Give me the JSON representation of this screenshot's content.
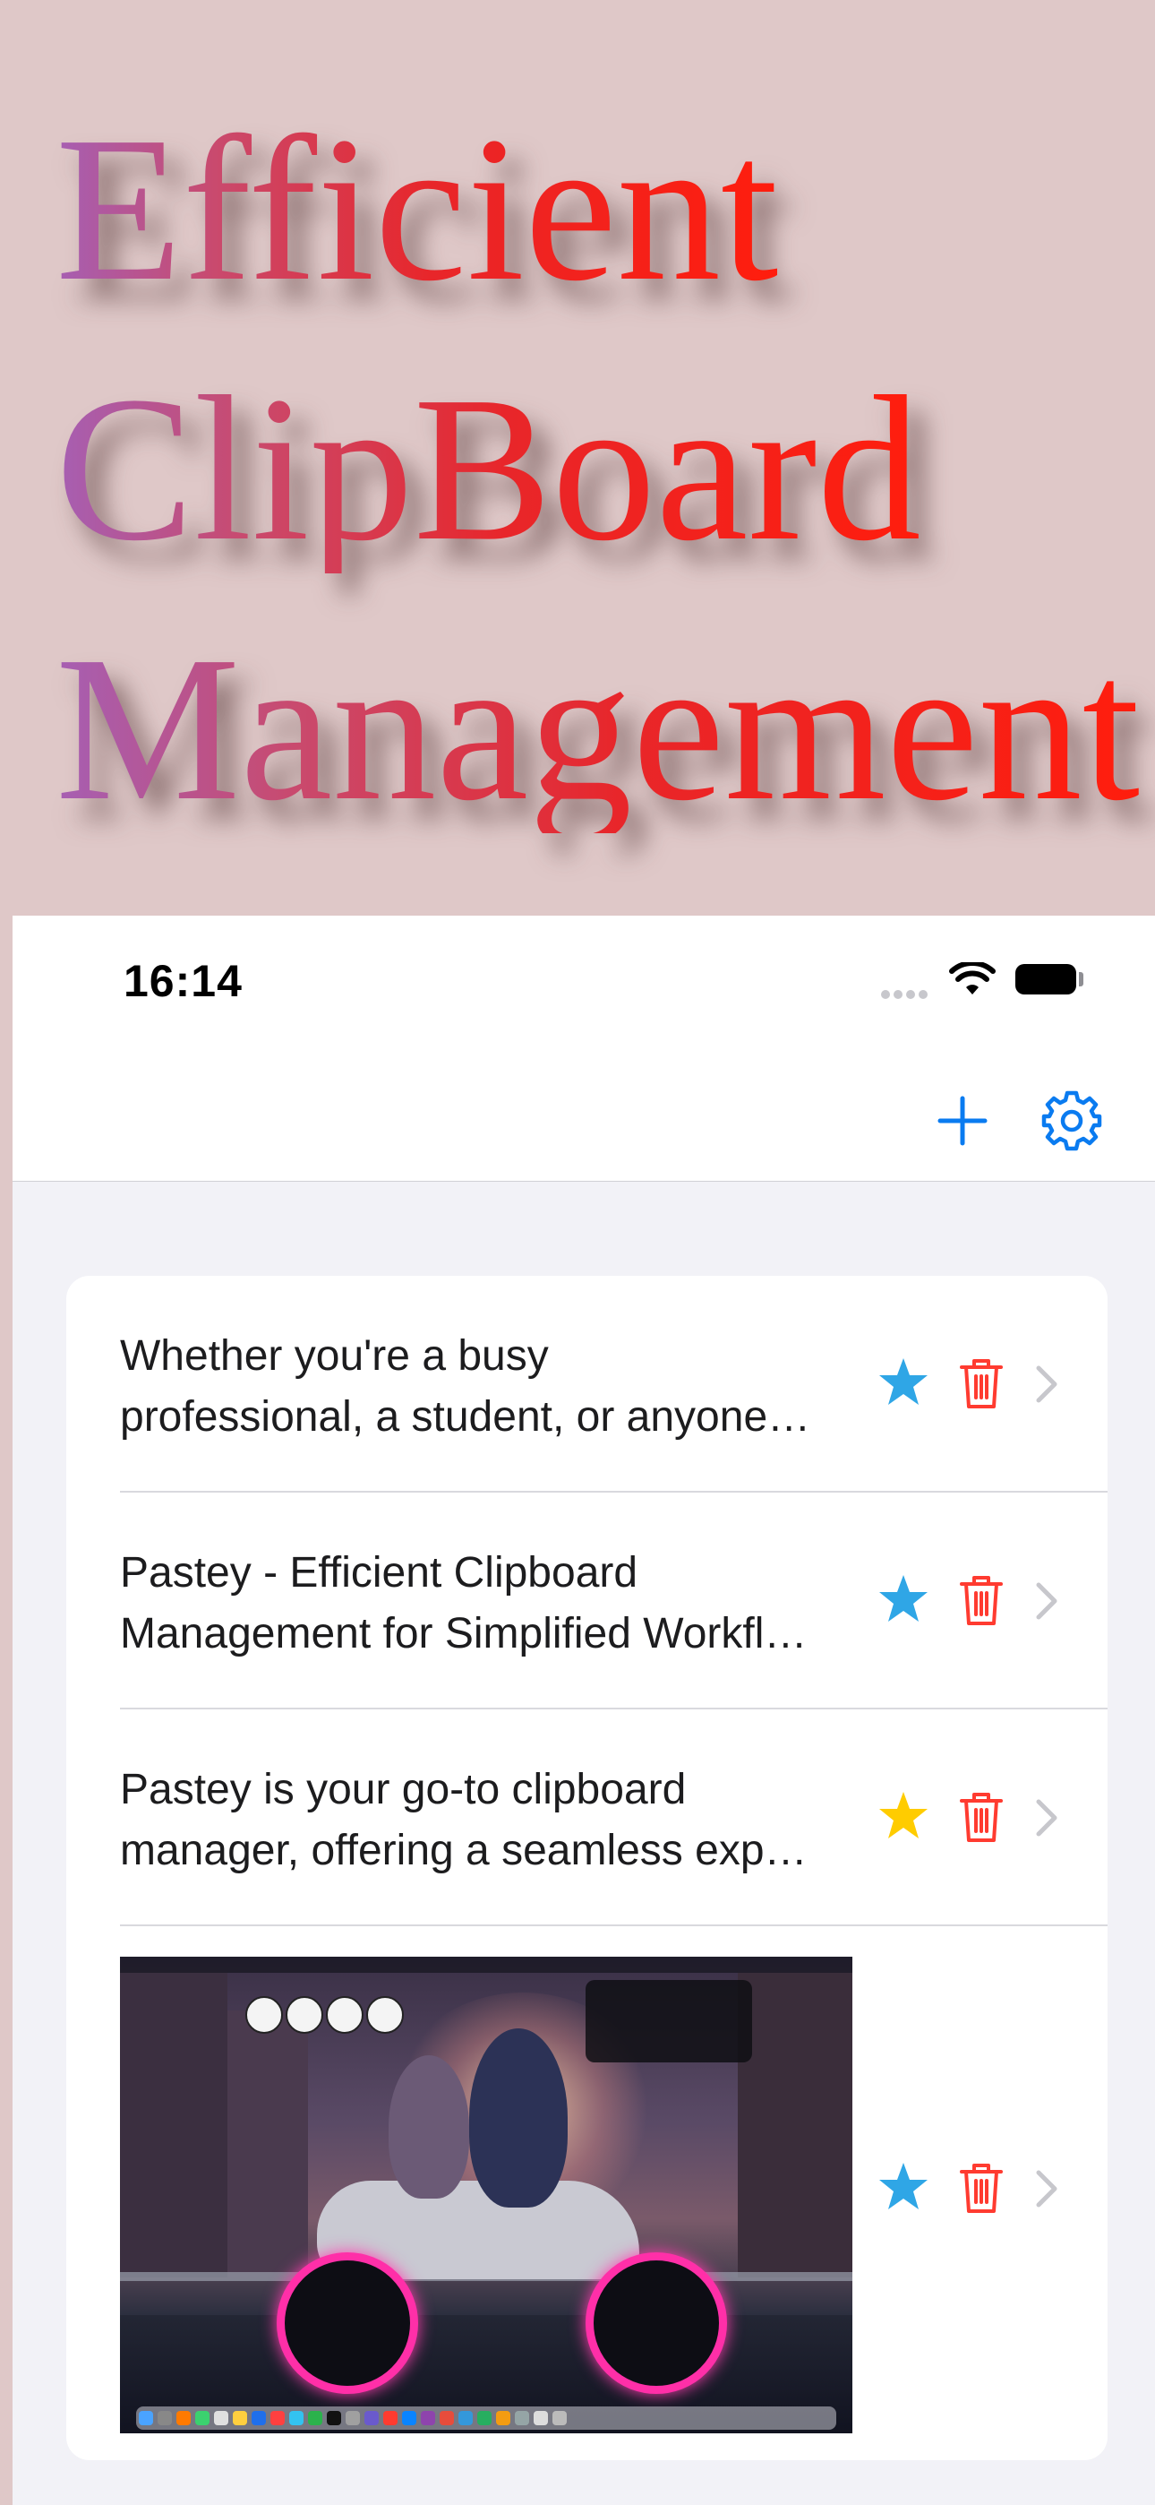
{
  "promo": {
    "line1": "Efficient",
    "line2": "ClipBoard",
    "line3": "Management"
  },
  "status_bar": {
    "time": "16:14"
  },
  "toolbar": {
    "add_icon": "plus-icon",
    "settings_icon": "gear-icon"
  },
  "colors": {
    "accent": "#0a7bf0",
    "star_blue": "#2fa6e6",
    "star_gold": "#ffcc00",
    "trash_red": "#ff3b30",
    "chevron": "#c7c7cc"
  },
  "clips": [
    {
      "line1": "Whether you're a busy",
      "line2": "professional, a student, or anyone…",
      "favorite": false
    },
    {
      "line1": "Pastey - Efficient Clipboard",
      "line2": "Management for Simplified Workfl…",
      "favorite": false
    },
    {
      "line1": "Pastey is your go-to clipboard",
      "line2": "manager, offering a seamless exp…",
      "favorite": true
    },
    {
      "type": "image",
      "image_description": "desktop-screenshot-motorcycle-wallpaper",
      "favorite": false
    }
  ]
}
